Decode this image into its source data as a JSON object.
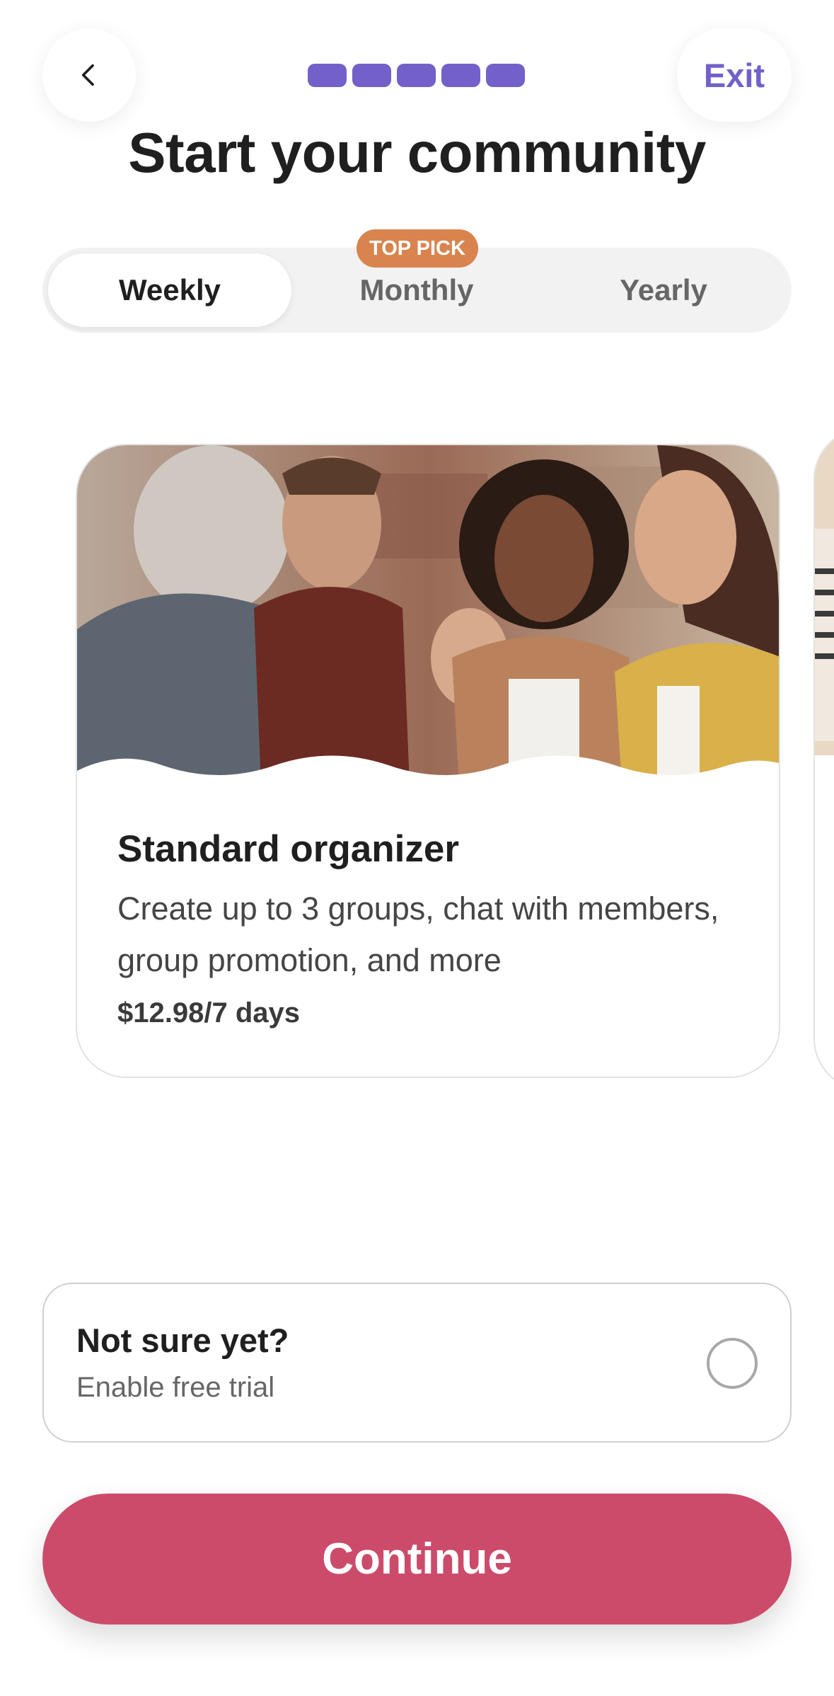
{
  "header": {
    "exit_label": "Exit",
    "progress_steps": 5,
    "progress_completed": 5
  },
  "title": "Start your community",
  "tabs": [
    {
      "label": "Weekly",
      "selected": true
    },
    {
      "label": "Monthly",
      "selected": false
    },
    {
      "label": "Yearly",
      "selected": false
    }
  ],
  "top_pick_badge": "TOP PICK",
  "plan_card": {
    "name": "Standard organizer",
    "description": "Create up to 3 groups, chat with members, group promotion, and more",
    "price": "$12.98/7 days"
  },
  "free_trial": {
    "title": "Not sure yet?",
    "subtitle": "Enable free trial",
    "enabled": false
  },
  "continue_label": "Continue",
  "colors": {
    "accent_purple": "#7360c9",
    "badge_orange": "#d9844e",
    "cta_pink": "#cc4b6b"
  }
}
